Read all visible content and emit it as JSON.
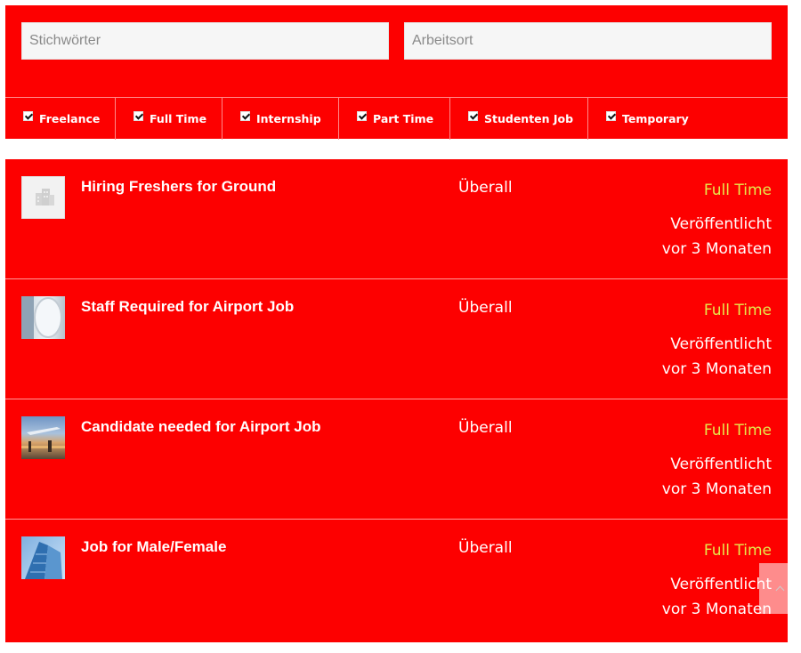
{
  "search": {
    "keywords_placeholder": "Stichwörter",
    "location_placeholder": "Arbeitsort"
  },
  "job_types": [
    {
      "label": "Freelance",
      "checked": true
    },
    {
      "label": "Full Time",
      "checked": true
    },
    {
      "label": "Internship",
      "checked": true
    },
    {
      "label": "Part Time",
      "checked": true
    },
    {
      "label": "Studenten Job",
      "checked": true
    },
    {
      "label": "Temporary",
      "checked": true
    }
  ],
  "jobs": [
    {
      "title": "Hiring Freshers for Ground",
      "location": "Überall",
      "type": "Full Time",
      "posted_line1": "Veröffentlicht",
      "posted_line2": "vor 3 Monaten",
      "logo_icon": "building-icon"
    },
    {
      "title": "Staff Required for Airport Job",
      "location": "Überall",
      "type": "Full Time",
      "posted_line1": "Veröffentlicht",
      "posted_line2": "vor 3 Monaten",
      "logo_icon": "airplane-window-icon"
    },
    {
      "title": "Candidate needed for Airport Job",
      "location": "Überall",
      "type": "Full Time",
      "posted_line1": "Veröffentlicht",
      "posted_line2": "vor 3 Monaten",
      "logo_icon": "airport-photo-icon"
    },
    {
      "title": "Job for Male/Female",
      "location": "Überall",
      "type": "Full Time",
      "posted_line1": "Veröffentlicht",
      "posted_line2": "vor 3 Monaten",
      "logo_icon": "skyscraper-photo-icon"
    }
  ],
  "colors": {
    "background_red": "#fd0000",
    "job_type_text": "#e6e84a"
  }
}
